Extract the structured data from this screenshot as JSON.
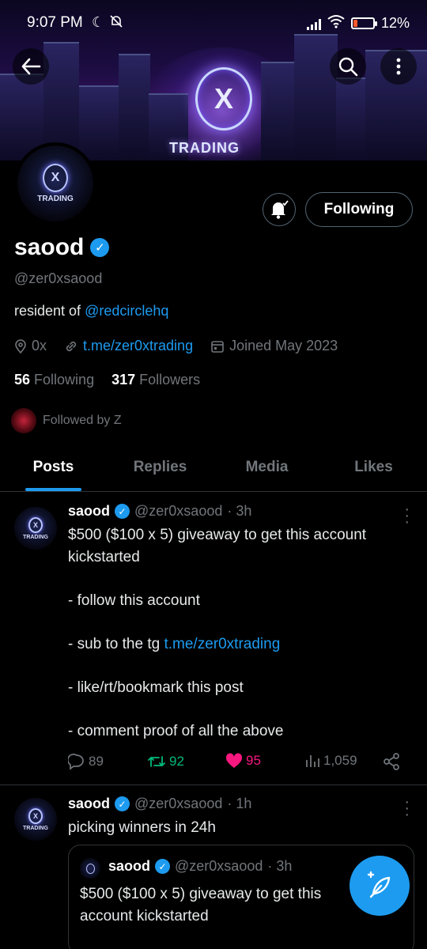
{
  "status_bar": {
    "time": "9:07 PM",
    "battery": "12%",
    "battery_level": 0.12
  },
  "banner": {
    "wordmark": "TRADING"
  },
  "avatar": {
    "label": "TRADING"
  },
  "profile": {
    "name": "saood",
    "handle": "@zer0xsaood",
    "bio_prefix": "resident of ",
    "bio_link": "@redcirclehq",
    "location": "0x",
    "website": "t.me/zer0xtrading",
    "joined": "Joined May 2023",
    "following_count": "56",
    "following_label": "Following",
    "followers_count": "317",
    "followers_label": "Followers",
    "followed_by": "Followed by Z",
    "follow_button": "Following"
  },
  "tabs": [
    "Posts",
    "Replies",
    "Media",
    "Likes"
  ],
  "posts": [
    {
      "name": "saood",
      "handle": "@zer0xsaood",
      "time": "· 3h",
      "line1": "$500 ($100 x 5) giveaway to get this account",
      "line2": "kickstarted",
      "line3": "- follow this account",
      "line4_prefix": "- sub to the tg ",
      "line4_link": "t.me/zer0xtrading",
      "line5": "- like/rt/bookmark this post",
      "line6": "- comment proof of all the above",
      "replies": "89",
      "reposts": "92",
      "likes": "95",
      "views": "1,059"
    },
    {
      "name": "saood",
      "handle": "@zer0xsaood",
      "time": "· 1h",
      "text": "picking winners in 24h",
      "quote": {
        "name": "saood",
        "handle": "@zer0xsaood",
        "time": "· 3h",
        "line1": "$500 ($100 x 5) giveaway to get this",
        "line2": "account kickstarted"
      }
    }
  ],
  "colors": {
    "accent": "#1d9bf0",
    "repost": "#00ba7c",
    "like": "#f91880",
    "muted": "#71767b"
  }
}
